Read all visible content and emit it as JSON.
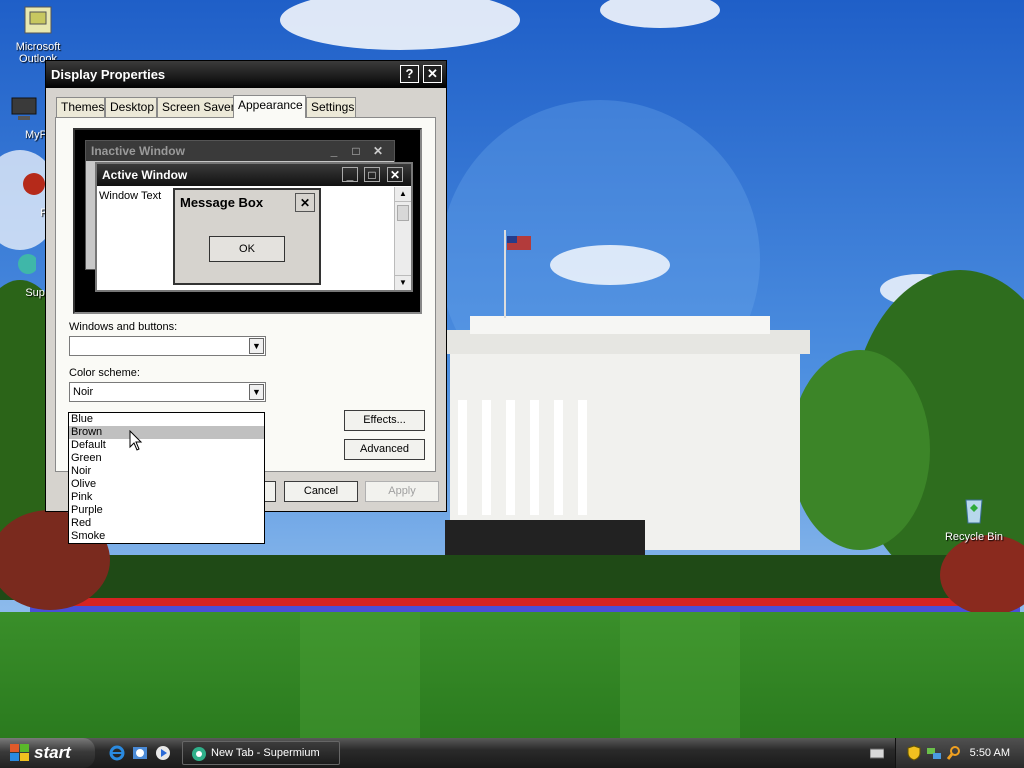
{
  "desktop": {
    "icons": [
      {
        "label": "Microsoft Outlook"
      },
      {
        "label": "MyPa"
      },
      {
        "label": "Peg"
      },
      {
        "label": "Super"
      },
      {
        "label": "Recycle Bin"
      }
    ]
  },
  "dialog": {
    "title": "Display Properties",
    "help_button": "?",
    "close_button": "✕",
    "tabs": [
      {
        "label": "Themes"
      },
      {
        "label": "Desktop"
      },
      {
        "label": "Screen Saver"
      },
      {
        "label": "Appearance"
      },
      {
        "label": "Settings"
      }
    ],
    "active_tab": "Appearance",
    "preview": {
      "inactive_title": "Inactive Window",
      "active_title": "Active Window",
      "window_text": "Window Text",
      "message_box_title": "Message Box",
      "ok_label": "OK"
    },
    "windows_buttons_label": "Windows and buttons:",
    "windows_buttons_value": "",
    "color_scheme_label": "Color scheme:",
    "color_scheme_value": "Noir",
    "color_scheme_options": [
      "Blue",
      "Brown",
      "Default",
      "Green",
      "Noir",
      "Olive",
      "Pink",
      "Purple",
      "Red",
      "Smoke"
    ],
    "highlighted_option": "Brown",
    "effects_label": "Effects...",
    "advanced_label": "Advanced",
    "cancel_label": "Cancel",
    "apply_label": "Apply"
  },
  "taskbar": {
    "start_label": "start",
    "task_button_label": "New Tab - Supermium",
    "clock": "5:50 AM"
  }
}
